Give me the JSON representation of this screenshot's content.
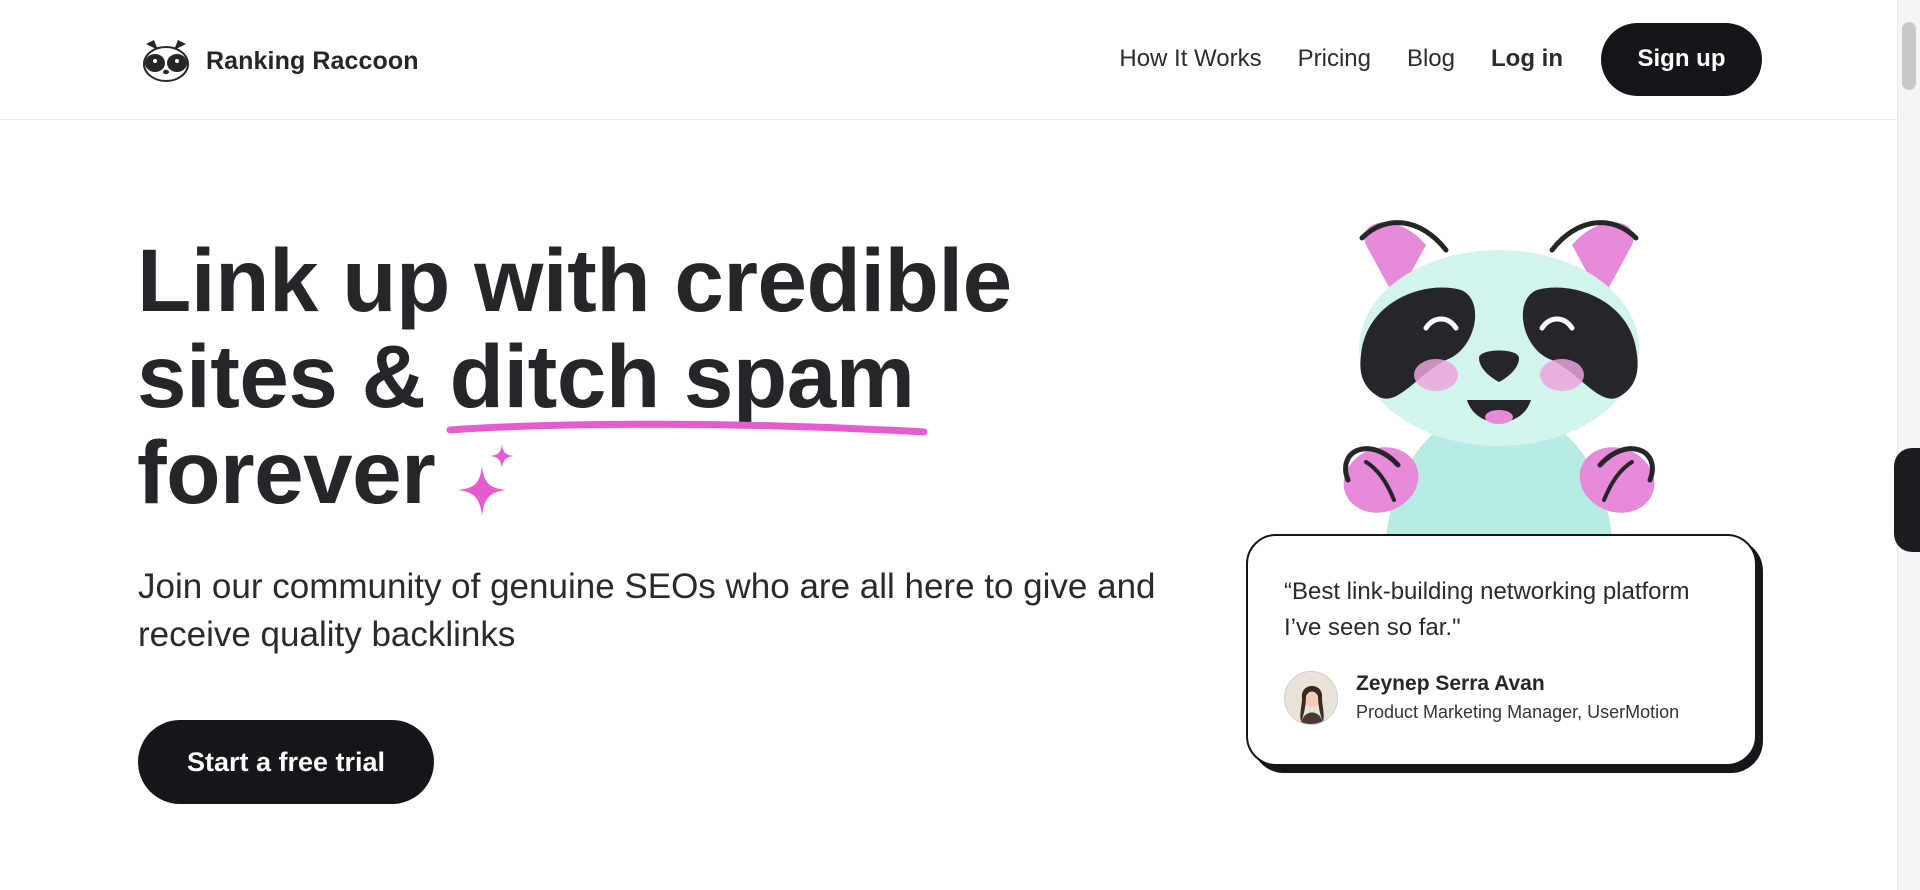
{
  "header": {
    "brand": "Ranking Raccoon",
    "logo_icon": "raccoon-face-icon",
    "nav": {
      "how_it_works": "How It Works",
      "pricing": "Pricing",
      "blog": "Blog",
      "login": "Log in",
      "signup": "Sign up"
    }
  },
  "hero": {
    "headline_line1": "Link up with credible",
    "headline_line2_prefix": "sites & ",
    "headline_highlight": "ditch spam",
    "headline_line3": "forever",
    "subtext": "Join our community of genuine SEOs who are all here to give and receive quality backlinks",
    "cta": "Start a free trial"
  },
  "testimonial": {
    "quote": "“Best link-building networking platform I’ve seen so far.\"",
    "name": "Zeynep Serra Avan",
    "title": "Product Marketing Manager, UserMotion"
  },
  "colors": {
    "brand_dark": "#16161a",
    "accent_pink": "#e65bd0",
    "mint": "#b8ece3"
  },
  "icons": {
    "sparkle": "sparkle-icon",
    "mascot": "raccoon-mascot",
    "avatar": "avatar"
  }
}
